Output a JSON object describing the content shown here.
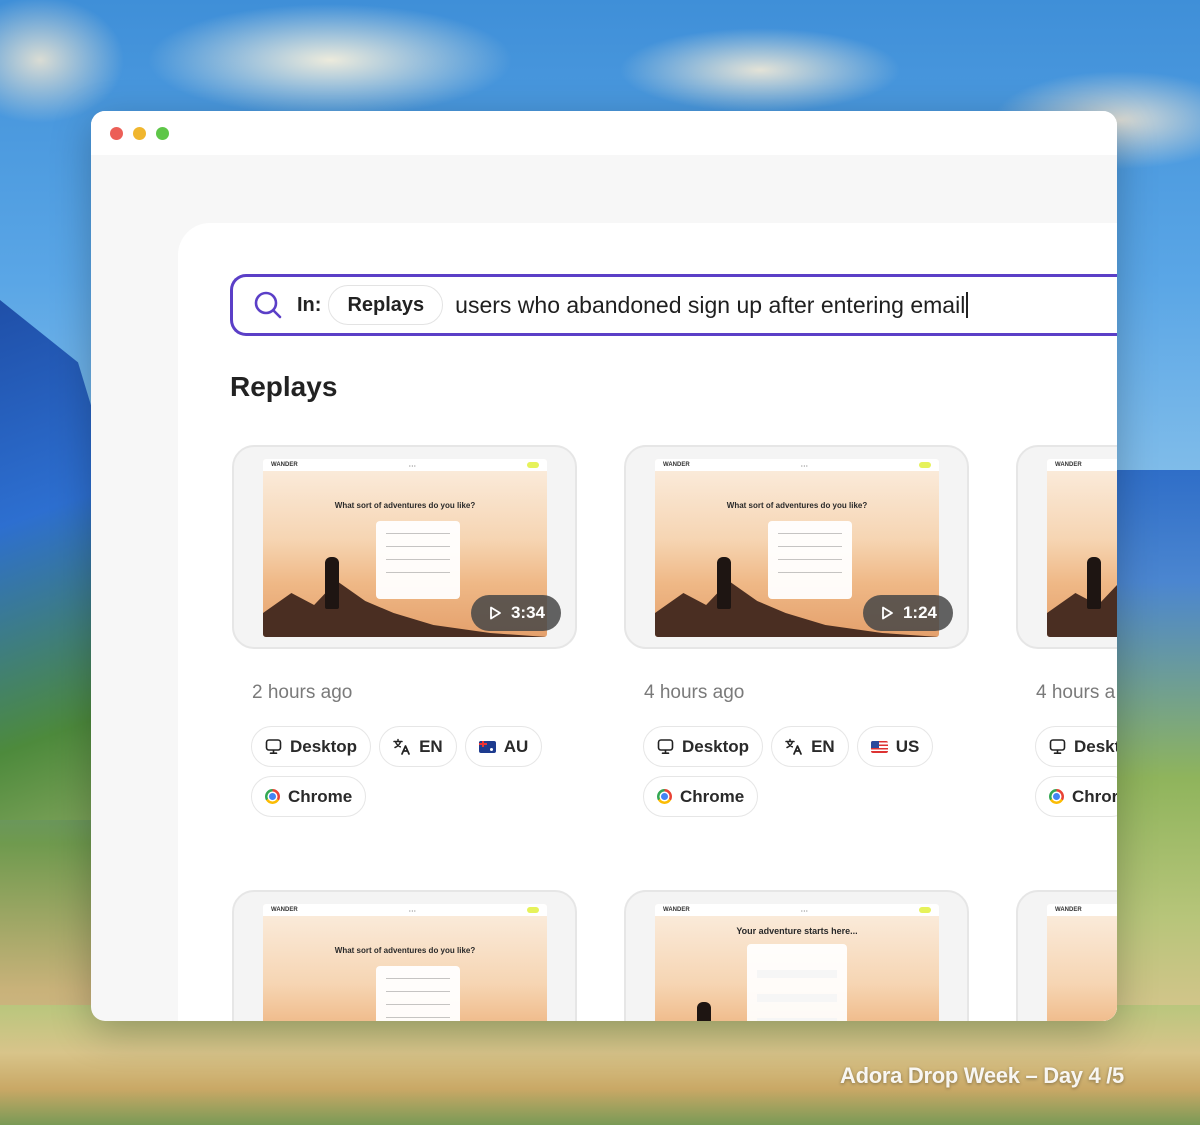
{
  "search": {
    "in_label": "In:",
    "scope": "Replays",
    "query": "users who abandoned sign up after entering email"
  },
  "section_title": "Replays",
  "replays": [
    {
      "duration": "3:34",
      "time_ago": "2 hours ago",
      "screen_brand": "WANDER",
      "screen_headline": "What sort of adventures do you like?",
      "device": "Desktop",
      "language": "EN",
      "country": "AU",
      "browser": "Chrome"
    },
    {
      "duration": "1:24",
      "time_ago": "4 hours ago",
      "screen_brand": "WANDER",
      "screen_headline": "What sort of adventures do you like?",
      "device": "Desktop",
      "language": "EN",
      "country": "US",
      "browser": "Chrome"
    },
    {
      "time_ago": "4 hours a",
      "screen_brand": "WANDER",
      "device": "Deskt",
      "browser": "Chror"
    },
    {
      "screen_brand": "WANDER",
      "screen_headline": "What sort of adventures do you like?"
    },
    {
      "screen_brand": "WANDER",
      "screen_headline": "Your adventure starts here..."
    },
    {
      "screen_brand": "WANDER"
    }
  ],
  "watermark": "Adora Drop Week – Day 4 /5",
  "icons": {
    "search": "search-icon",
    "play": "play-icon",
    "desktop": "monitor-icon",
    "language": "translate-icon",
    "browser": "chrome-icon"
  },
  "colors": {
    "accent": "#5b3fc7",
    "traffic_red": "#ec5f57",
    "traffic_yellow": "#f0b62e",
    "traffic_green": "#5ec648"
  }
}
